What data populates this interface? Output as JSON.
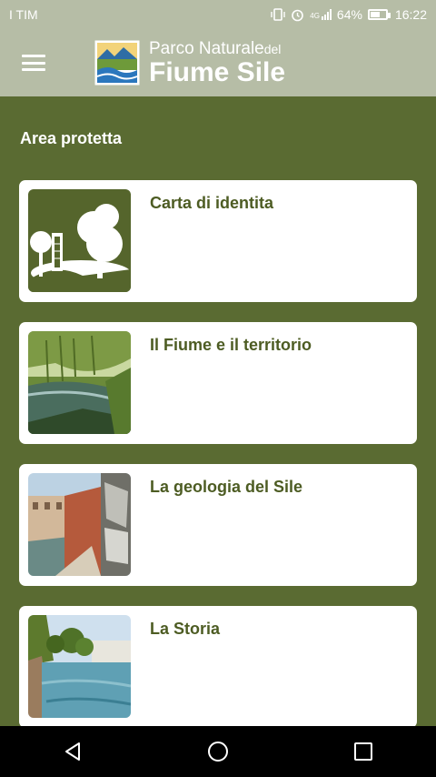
{
  "status_bar": {
    "carrier": "I TIM",
    "icons": [
      "vibrate-icon",
      "alarm-icon",
      "signal-4g-icon",
      "battery-icon"
    ],
    "network": "4G",
    "battery_percent": "64%",
    "battery_level": 0.64,
    "time": "16:22"
  },
  "app_bar": {
    "logo_line1": "Parco Naturale",
    "logo_line1_small": "del",
    "logo_line2": "Fiume Sile",
    "menu_icon": "hamburger-menu-icon"
  },
  "section": {
    "title": "Area protetta"
  },
  "cards": [
    {
      "title": "Carta di identita"
    },
    {
      "title": "Il Fiume e il territorio"
    },
    {
      "title": "La geologia del Sile"
    },
    {
      "title": "La Storia"
    }
  ],
  "nav_bar": {
    "icons": [
      "back-icon",
      "home-icon",
      "recents-icon"
    ]
  },
  "colors": {
    "header": "#b6bda6",
    "background": "#5a6b32",
    "card_title": "#4d5c23",
    "card": "#ffffff"
  }
}
